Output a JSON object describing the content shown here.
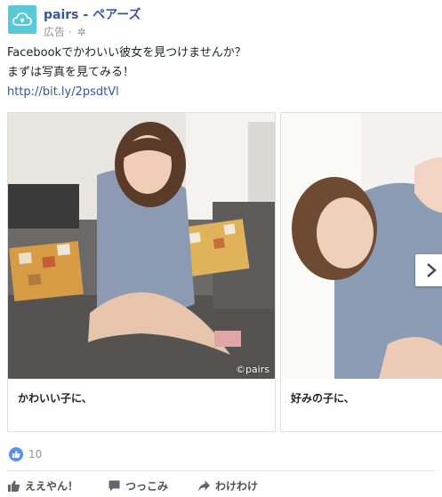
{
  "post": {
    "page_name": "pairs - ペアーズ",
    "sponsored_label": "広告 · ",
    "text_line1": "Facebookでかわいい彼女を見つけませんか？",
    "text_line2": "まずは写真を見てみる！",
    "link": "http://bit.ly/2psdtVl"
  },
  "carousel": {
    "cards": [
      {
        "caption": "かわいい子に、",
        "watermark": "©pairs"
      },
      {
        "caption": "好みの子に、"
      }
    ]
  },
  "reactions": {
    "like_count": "10"
  },
  "actions": {
    "like_label": "ええやん！",
    "comment_label": "つっこみ",
    "share_label": "わけわけ"
  },
  "colors": {
    "brand_blue": "#365899",
    "avatar_bg": "#5ac8d6",
    "like_badge": "#5890ff",
    "meta_gray": "#90949c"
  },
  "icons": [
    "cloud-logo-icon",
    "globe-icon",
    "chevron-right-icon",
    "thumbs-up-icon",
    "comment-icon",
    "share-arrow-icon"
  ]
}
